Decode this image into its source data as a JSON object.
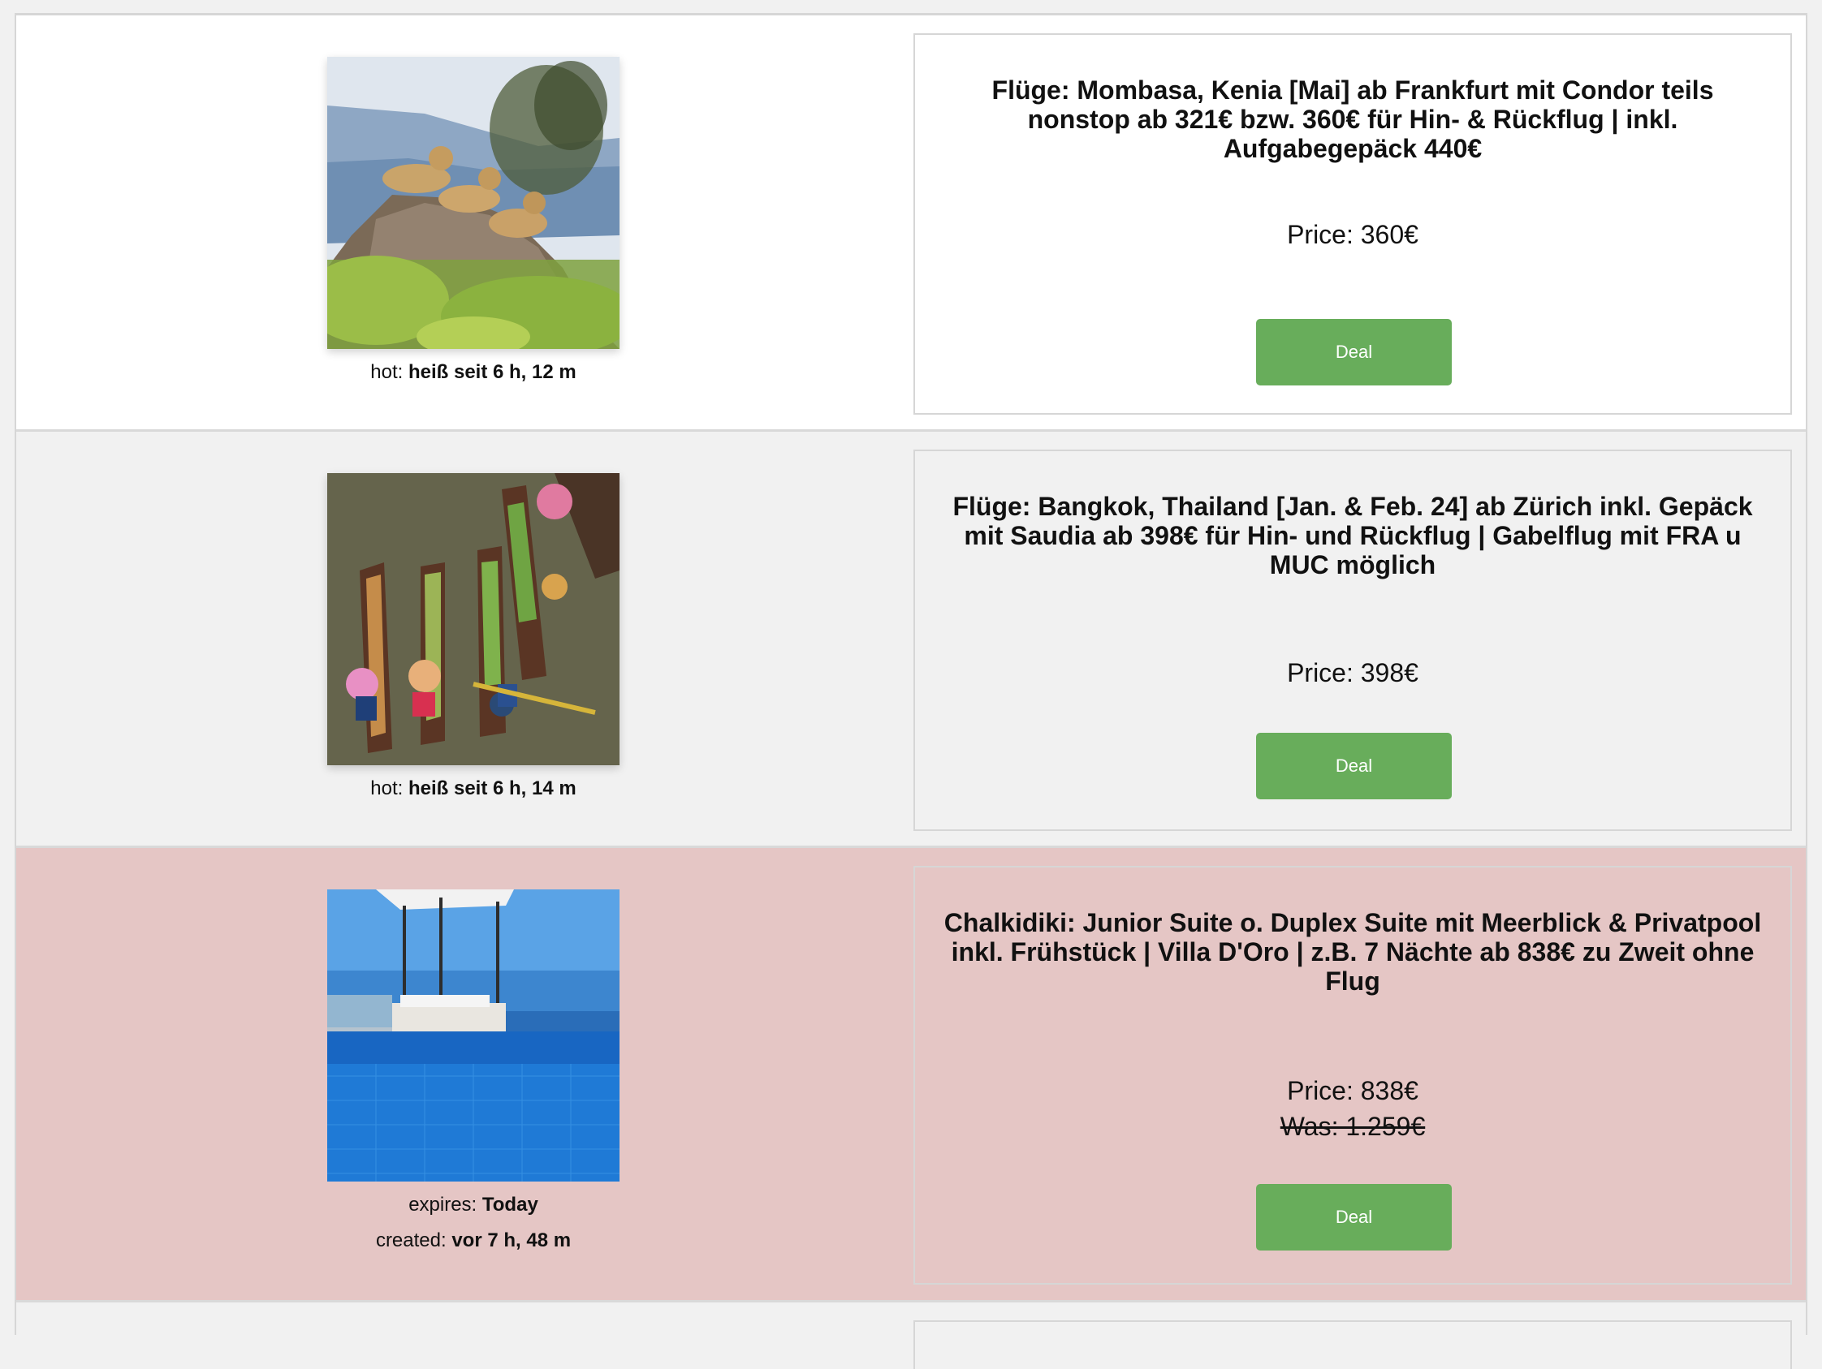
{
  "deals": [
    {
      "title": "Flüge: Mombasa, Kenia [Mai] ab Frankfurt mit Condor teils nonstop ab 321€ bzw. 360€ für Hin- & Rückflug | inkl. Aufgabegepäck 440€",
      "price": "Price: 360€",
      "button": "Deal",
      "meta_label": "hot: ",
      "meta_value": "heiß seit 6 h, 12 m",
      "image": "lions-on-rock-photo"
    },
    {
      "title": "Flüge: Bangkok, Thailand [Jan. & Feb. 24] ab Zürich inkl. Gepäck mit Saudia ab 398€ für Hin- und Rückflug | Gabelflug mit FRA u MUC möglich",
      "price": "Price: 398€",
      "button": "Deal",
      "meta_label": "hot: ",
      "meta_value": "heiß seit 6 h, 14 m",
      "image": "floating-market-boats-photo"
    },
    {
      "title": "Chalkidiki: Junior Suite o. Duplex Suite mit Meerblick & Privatpool inkl. Frühstück | Villa D'Oro | z.B. 7 Nächte ab 838€ zu Zweit ohne Flug",
      "price": "Price: 838€",
      "was": "Was: 1.259€",
      "button": "Deal",
      "expires_label": "expires: ",
      "expires_value": "Today",
      "created_label": "created: ",
      "created_value": "vor 7 h, 48 m",
      "image": "pool-sea-view-photo"
    }
  ],
  "colors": {
    "button": "#68ad5b",
    "expired_row": "#e5c6c5",
    "alt_row": "#f1f1f1"
  }
}
